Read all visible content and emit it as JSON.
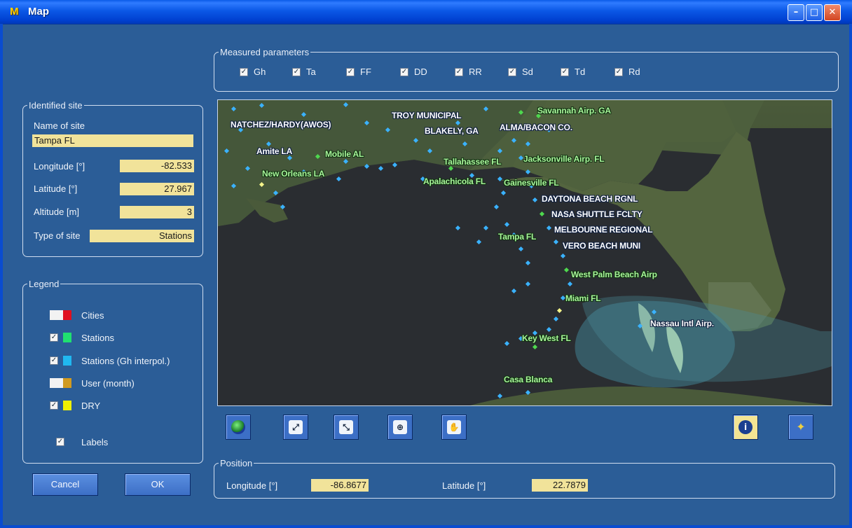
{
  "window": {
    "title": "Map",
    "app_icon_glyph": "M"
  },
  "identified_site": {
    "legend": "Identified site",
    "name_label": "Name of site",
    "name_value": "Tampa FL",
    "longitude_label": "Longitude [°]",
    "longitude_value": "-82.533",
    "latitude_label": "Latitude [°]",
    "latitude_value": "27.967",
    "altitude_label": "Altitude [m]",
    "altitude_value": "3",
    "type_label": "Type of site",
    "type_value": "Stations"
  },
  "legend_panel": {
    "legend": "Legend",
    "items": [
      {
        "label": "Cities",
        "checked": false,
        "color": "#e01020"
      },
      {
        "label": "Stations",
        "checked": true,
        "color": "#20e070"
      },
      {
        "label": "Stations (Gh interpol.)",
        "checked": true,
        "color": "#20b8f0"
      },
      {
        "label": "User (month)",
        "checked": false,
        "color": "#d09a20"
      },
      {
        "label": "DRY",
        "checked": true,
        "color": "#f0f000"
      }
    ],
    "labels_label": "Labels",
    "labels_checked": true
  },
  "buttons": {
    "cancel": "Cancel",
    "ok": "OK"
  },
  "parameters": {
    "legend": "Measured parameters",
    "items": [
      "Gh",
      "Ta",
      "FF",
      "DD",
      "RR",
      "Sd",
      "Td",
      "Rd"
    ]
  },
  "map": {
    "labels": [
      {
        "text": "Savannah Airp. GA",
        "color": "green"
      },
      {
        "text": "TROY MUNICIPAL",
        "color": "white"
      },
      {
        "text": "NATCHEZ/HARDY(AWOS)",
        "color": "white"
      },
      {
        "text": "BLAKELY, GA",
        "color": "white"
      },
      {
        "text": "ALMA/BACON CO.",
        "color": "white"
      },
      {
        "text": "Amite LA",
        "color": "white"
      },
      {
        "text": "Mobile AL",
        "color": "green"
      },
      {
        "text": "Tallahassee FL",
        "color": "green"
      },
      {
        "text": "Jacksonville Airp. FL",
        "color": "green"
      },
      {
        "text": "New Orleans LA",
        "color": "green"
      },
      {
        "text": "Apalachicola FL",
        "color": "green"
      },
      {
        "text": "Gainesville FL",
        "color": "green"
      },
      {
        "text": "DAYTONA BEACH RGNL",
        "color": "white"
      },
      {
        "text": "NASA SHUTTLE FCLTY",
        "color": "white"
      },
      {
        "text": "MELBOURNE REGIONAL",
        "color": "white"
      },
      {
        "text": "Tampa FL",
        "color": "green"
      },
      {
        "text": "VERO BEACH MUNI",
        "color": "white"
      },
      {
        "text": "West Palm Beach Airp",
        "color": "green"
      },
      {
        "text": "Miami FL",
        "color": "green"
      },
      {
        "text": "Nassau Intl Airp.",
        "color": "white"
      },
      {
        "text": "Key West FL",
        "color": "green"
      },
      {
        "text": "Casa Blanca",
        "color": "green"
      }
    ]
  },
  "toolbar": {
    "globe_icon": "globe-icon",
    "zoom_full_icon": "expand-icon",
    "zoom_fit_icon": "collapse-icon",
    "zoom_in_icon": "magnifier-icon",
    "pan_icon": "hand-icon",
    "info_icon": "info-icon",
    "pin_icon": "pin-icon"
  },
  "position": {
    "legend": "Position",
    "longitude_label": "Longitude [°]",
    "longitude_value": "-86.8677",
    "latitude_label": "Latitude [°]",
    "latitude_value": "22.7879"
  }
}
